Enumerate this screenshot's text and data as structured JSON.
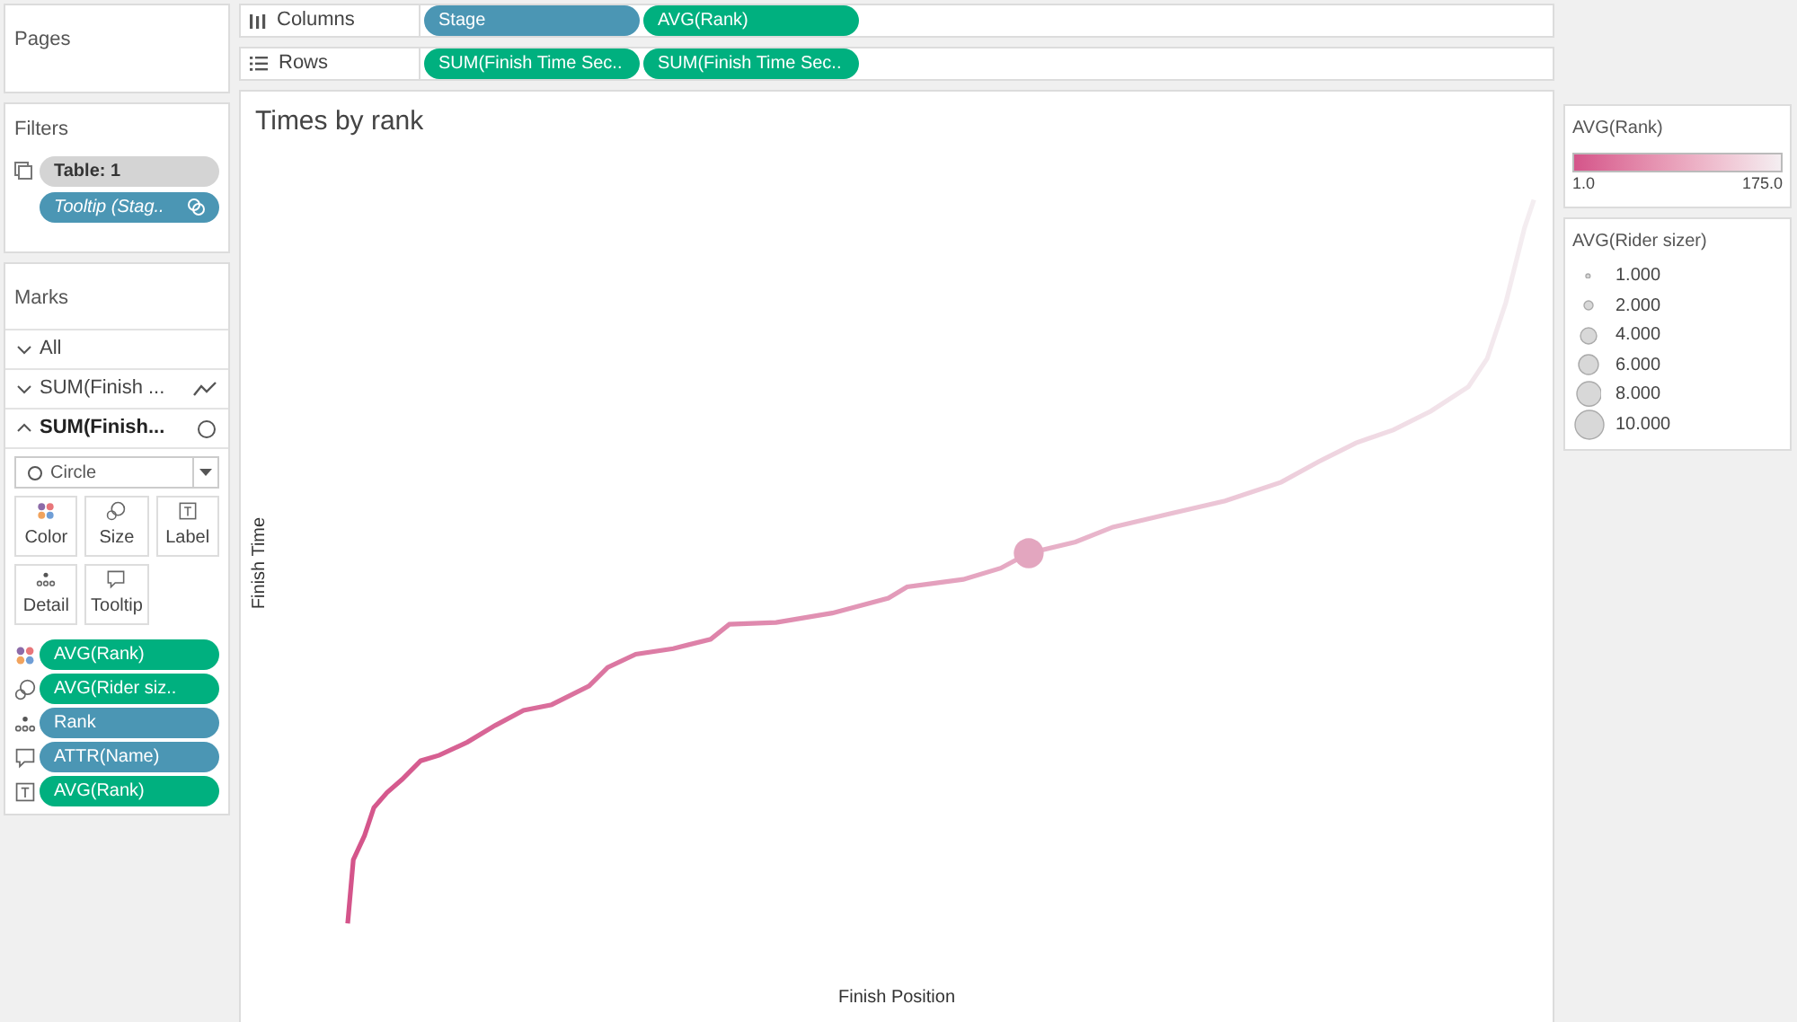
{
  "pages": {
    "title": "Pages"
  },
  "shelves": [
    {
      "kind": "columns",
      "label": "Columns",
      "pills": [
        {
          "text": "Stage",
          "kind": "dimension"
        },
        {
          "text": "AVG(Rank)",
          "kind": "measure"
        }
      ]
    },
    {
      "kind": "rows",
      "label": "Rows",
      "pills": [
        {
          "text": "SUM(Finish Time Sec..",
          "kind": "measure"
        },
        {
          "text": "SUM(Finish Time Sec..",
          "kind": "measure"
        }
      ]
    }
  ],
  "filters": {
    "title": "Filters",
    "items": [
      {
        "text": "Table: 1",
        "kind": "plain"
      },
      {
        "text": "Tooltip (Stag..",
        "kind": "dimension"
      }
    ]
  },
  "marks": {
    "title": "Marks",
    "layers": [
      {
        "label": "All",
        "expanded": false,
        "kind": "all"
      },
      {
        "label": "SUM(Finish ...",
        "expanded": false,
        "kind": "line"
      },
      {
        "label": "SUM(Finish...",
        "expanded": true,
        "kind": "circle"
      }
    ],
    "mark_type": "Circle",
    "buttons": [
      {
        "label": "Color",
        "kind": "color"
      },
      {
        "label": "Size",
        "kind": "size"
      },
      {
        "label": "Label",
        "kind": "label"
      },
      {
        "label": "Detail",
        "kind": "detail"
      },
      {
        "label": "Tooltip",
        "kind": "tooltip"
      }
    ],
    "fields": [
      {
        "kind": "color",
        "text": "AVG(Rank)",
        "dimension": false
      },
      {
        "kind": "size",
        "text": "AVG(Rider siz..",
        "dimension": false
      },
      {
        "kind": "detail",
        "text": "Rank",
        "dimension": true
      },
      {
        "kind": "tooltip",
        "text": "ATTR(Name)",
        "dimension": true
      },
      {
        "kind": "label",
        "text": "AVG(Rank)",
        "dimension": false
      }
    ]
  },
  "chart": {
    "title": "Times by rank",
    "xlabel": "Finish Position",
    "ylabel": "Finish Time"
  },
  "color_legend": {
    "title": "AVG(Rank)",
    "min": "1.0",
    "max": "175.0"
  },
  "size_legend": {
    "title": "AVG(Rider sizer)",
    "entries": [
      "1.000",
      "2.000",
      "4.000",
      "6.000",
      "8.000",
      "10.000"
    ]
  }
}
